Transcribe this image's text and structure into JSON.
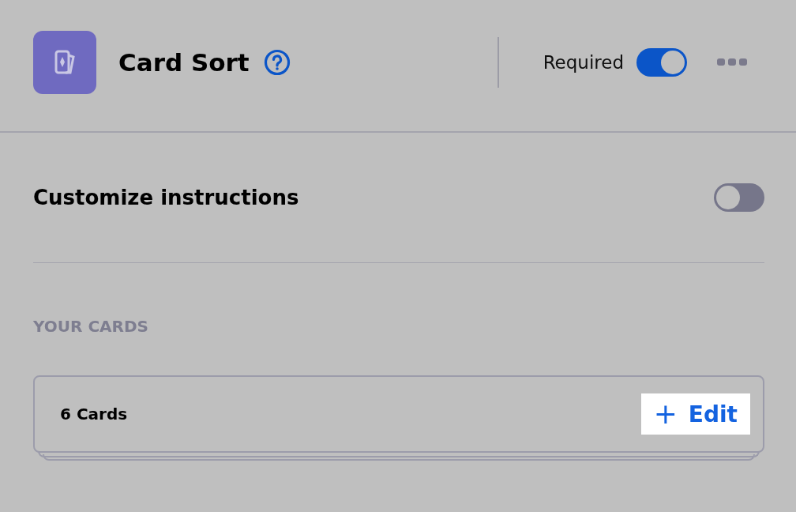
{
  "header": {
    "title": "Card Sort",
    "required_label": "Required",
    "required": {
      "on": true
    }
  },
  "customize": {
    "label": "Customize instructions",
    "on": false
  },
  "cards_section": {
    "heading": "YOUR CARDS",
    "count": "6 Cards",
    "edit_button": {
      "icon": "+",
      "label": "Edit"
    }
  }
}
